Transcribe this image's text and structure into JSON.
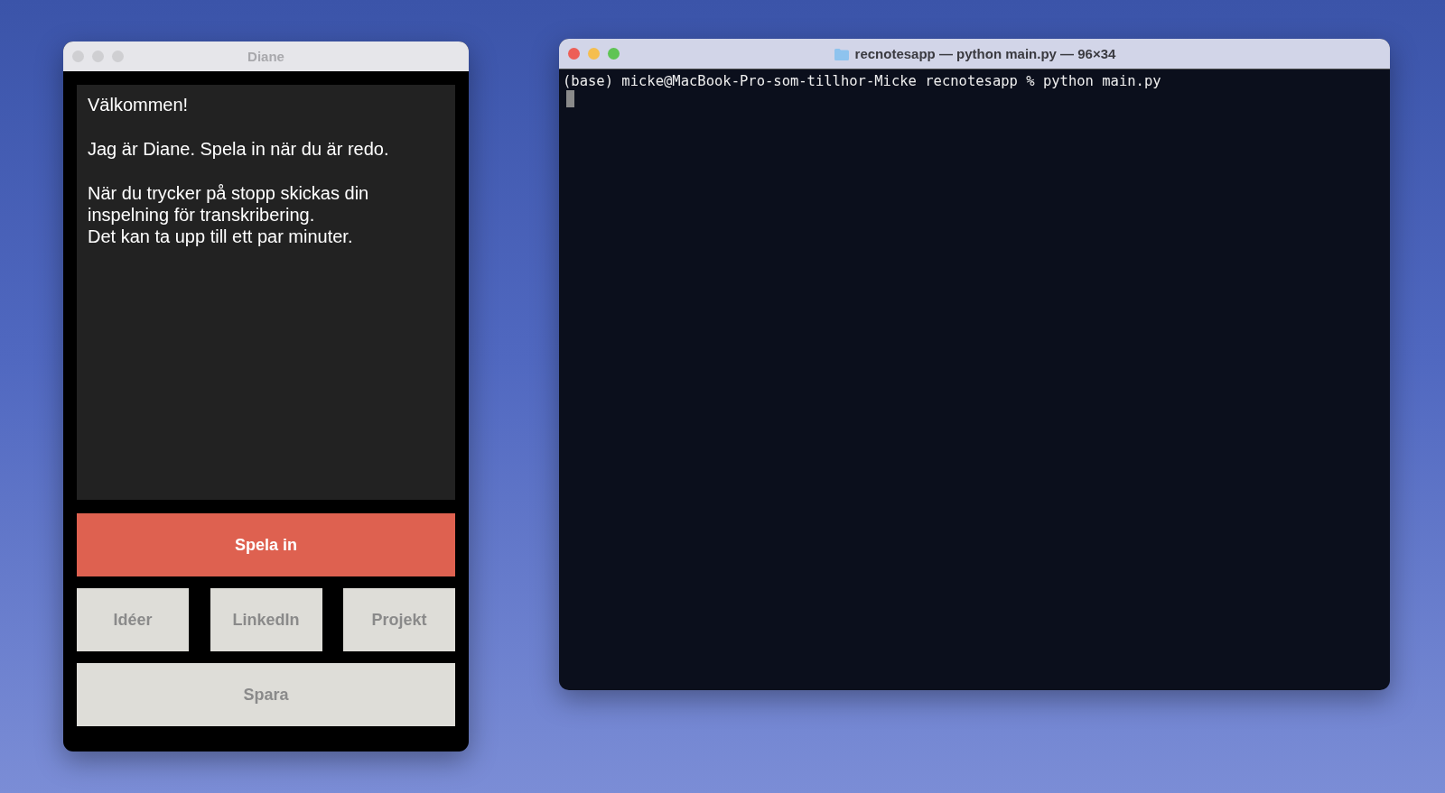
{
  "windows": [
    {
      "kind": "app",
      "title": "Diane",
      "active": false,
      "message": [
        "Välkommen!",
        "Jag är Diane. Spela in när du är redo.",
        "När du trycker på stopp skickas din\ninspelning för transkribering.\nDet kan ta upp till ett par minuter."
      ],
      "buttons": [
        {
          "label": "Spela in",
          "kind": "primary"
        },
        {
          "label": "Idéer",
          "kind": "category"
        },
        {
          "label": "LinkedIn",
          "kind": "category"
        },
        {
          "label": "Projekt",
          "kind": "category"
        },
        {
          "label": "Spara",
          "kind": "wide"
        }
      ]
    },
    {
      "kind": "terminal",
      "title": "recnotesapp — python main.py — 96×34",
      "active": true,
      "lines": [
        "(base) micke@MacBook-Pro-som-tillhor-Micke recnotesapp % python main.py"
      ]
    }
  ]
}
